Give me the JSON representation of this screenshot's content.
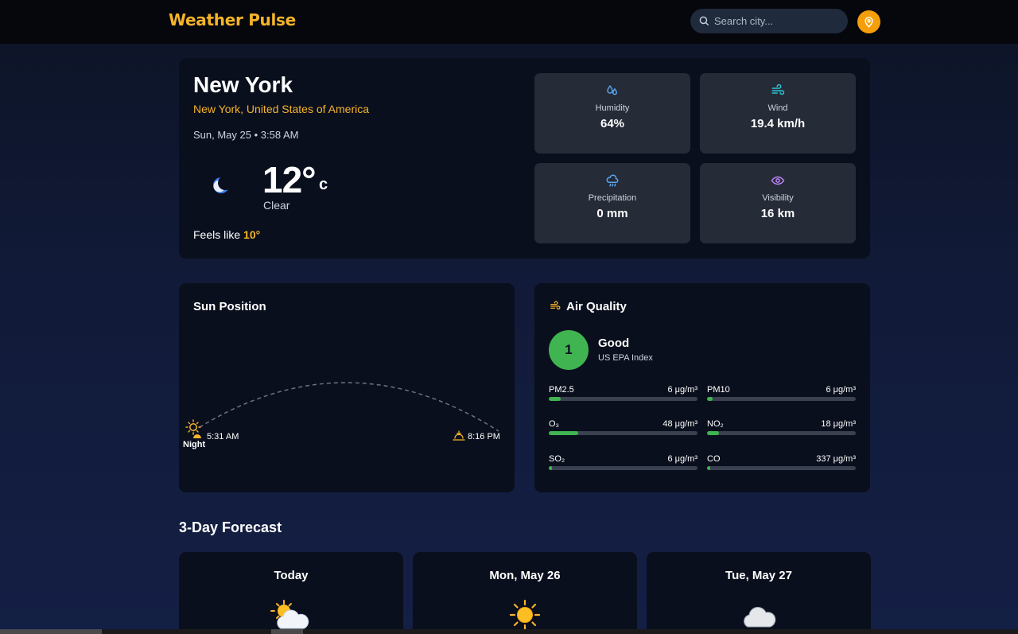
{
  "app": {
    "title": "Weather Pulse"
  },
  "search": {
    "placeholder": "Search city..."
  },
  "current": {
    "city": "New York",
    "region": "New York, United States of America",
    "datetime": "Sun, May 25 • 3:58 AM",
    "temp": "12°",
    "unit": "c",
    "condition": "Clear",
    "feels_label": "Feels like",
    "feels_value": "10°",
    "icon": "moon-icon"
  },
  "stats": [
    {
      "label": "Humidity",
      "value": "64%",
      "icon": "droplet-icon",
      "color": "#5aa5ee"
    },
    {
      "label": "Wind",
      "value": "19.4 km/h",
      "icon": "wind-icon",
      "color": "#2ec4d6"
    },
    {
      "label": "Precipitation",
      "value": "0 mm",
      "icon": "cloud-rain-icon",
      "color": "#5aa5ee"
    },
    {
      "label": "Visibility",
      "value": "16 km",
      "icon": "eye-icon",
      "color": "#c084fc"
    }
  ],
  "sun": {
    "title": "Sun Position",
    "sunrise": "5:31 AM",
    "sunset": "8:16 PM",
    "phase": "Night"
  },
  "air": {
    "title": "Air Quality",
    "index": "1",
    "label": "Good",
    "scale": "US EPA Index",
    "pollutants": [
      {
        "name": "PM2.5",
        "value": "6 μg/m³",
        "level": 0.08
      },
      {
        "name": "PM10",
        "value": "6 μg/m³",
        "level": 0.04
      },
      {
        "name": "O₃",
        "value": "48 μg/m³",
        "level": 0.2
      },
      {
        "name": "NO₂",
        "value": "18 μg/m³",
        "level": 0.08
      },
      {
        "name": "SO₂",
        "value": "6 μg/m³",
        "level": 0.02
      },
      {
        "name": "CO",
        "value": "337 μg/m³",
        "level": 0.02
      }
    ]
  },
  "forecast": {
    "title": "3-Day Forecast",
    "days": [
      {
        "day": "Today",
        "icon": "partly-cloudy-icon"
      },
      {
        "day": "Mon, May 26",
        "icon": "sun-icon"
      },
      {
        "day": "Tue, May 27",
        "icon": "cloud-icon"
      }
    ]
  },
  "colors": {
    "accent": "#f5b42a",
    "good": "#3fb450",
    "card": "#0a0f1d",
    "tile": "#252b37"
  }
}
